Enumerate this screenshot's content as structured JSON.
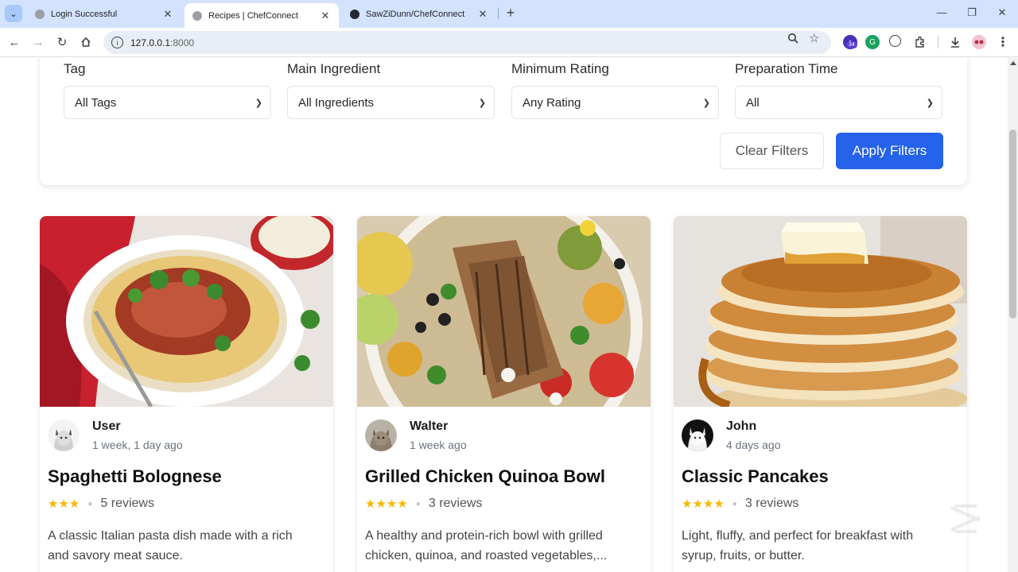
{
  "browser": {
    "tabs": [
      {
        "title": "Login Successful",
        "active": false
      },
      {
        "title": "Recipes | ChefConnect",
        "active": true
      },
      {
        "title": "SawZiDunn/ChefConnect",
        "active": false
      }
    ],
    "url_host": "127.0.0.1",
    "url_port": ":8000",
    "extension_badge": "34",
    "icons": [
      "back-icon",
      "forward-icon",
      "reload-icon",
      "home-icon",
      "zoom-icon",
      "bookmark-star-icon",
      "extensions-icon",
      "download-icon",
      "menu-kebab-icon"
    ]
  },
  "filters": {
    "tag": {
      "label": "Tag",
      "value": "All Tags"
    },
    "ingredient": {
      "label": "Main Ingredient",
      "value": "All Ingredients"
    },
    "rating": {
      "label": "Minimum Rating",
      "value": "Any Rating"
    },
    "time": {
      "label": "Preparation Time",
      "value": "All"
    },
    "clear_label": "Clear Filters",
    "apply_label": "Apply Filters",
    "accent": "#2563eb"
  },
  "recipes": [
    {
      "author": "User",
      "time": "1 week, 1 day ago",
      "title": "Spaghetti Bolognese",
      "stars": "★★★",
      "star_count": 3,
      "reviews": "5 reviews",
      "desc_line1": "A classic Italian pasta dish made with a rich",
      "desc_line2": "and savory meat sauce."
    },
    {
      "author": "Walter",
      "time": "1 week ago",
      "title": "Grilled Chicken Quinoa Bowl",
      "stars": "★★★★",
      "star_count": 4,
      "reviews": "3 reviews",
      "desc_line1": "A healthy and protein-rich bowl with grilled",
      "desc_line2": "chicken, quinoa, and roasted vegetables,..."
    },
    {
      "author": "John",
      "time": "4 days ago",
      "title": "Classic Pancakes",
      "stars": "★★★★",
      "star_count": 4,
      "reviews": "3 reviews",
      "desc_line1": "Light, fluffy, and perfect for breakfast with",
      "desc_line2": "syrup, fruits, or butter."
    }
  ]
}
